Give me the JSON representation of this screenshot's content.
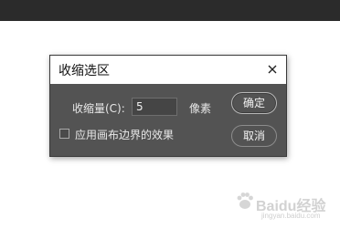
{
  "dialog": {
    "title": "收缩选区",
    "close_icon": "close-icon",
    "contract_label": "收缩量(C):",
    "contract_value": "5",
    "unit": "像素",
    "ok_label": "确定",
    "cancel_label": "取消",
    "apply_canvas_bounds_label": "应用画布边界的效果",
    "apply_canvas_bounds_checked": false
  },
  "watermark": {
    "text": "Baidu经验",
    "sub": "jingyan.baidu.com"
  },
  "colors": {
    "dialog_bg": "#535353",
    "titlebar_bg": "#ffffff",
    "topbar_bg": "#2b2b2b",
    "text": "#e8e8e8"
  }
}
